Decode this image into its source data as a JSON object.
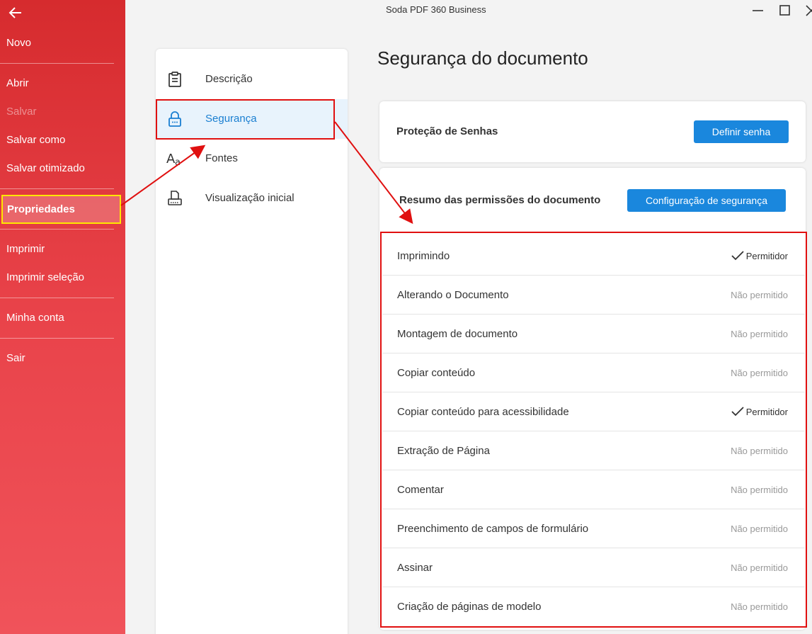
{
  "window": {
    "title": "Soda PDF 360 Business"
  },
  "sidebar": {
    "items": [
      {
        "label": "Novo"
      },
      {
        "label": "Abrir"
      },
      {
        "label": "Salvar"
      },
      {
        "label": "Salvar como"
      },
      {
        "label": "Salvar otimizado"
      },
      {
        "label": "Propriedades"
      },
      {
        "label": "Imprimir"
      },
      {
        "label": "Imprimir seleção"
      },
      {
        "label": "Minha conta"
      },
      {
        "label": "Sair"
      }
    ]
  },
  "nav": {
    "items": [
      {
        "label": "Descrição",
        "icon": "clipboard-icon"
      },
      {
        "label": "Segurança",
        "icon": "lock-icon"
      },
      {
        "label": "Fontes",
        "icon": "font-aa-icon"
      },
      {
        "label": "Visualização inicial",
        "icon": "printer-page-icon"
      }
    ]
  },
  "main": {
    "title": "Segurança do documento",
    "password_card": {
      "label": "Proteção de Senhas",
      "button": "Definir senha"
    },
    "permissions_card": {
      "label": "Resumo das permissões do documento",
      "button": "Configuração de segurança"
    },
    "permissions": [
      {
        "label": "Imprimindo",
        "status": "Permitidor",
        "allowed": true
      },
      {
        "label": "Alterando o Documento",
        "status": "Não permitido",
        "allowed": false
      },
      {
        "label": "Montagem de documento",
        "status": "Não permitido",
        "allowed": false
      },
      {
        "label": "Copiar conteúdo",
        "status": "Não permitido",
        "allowed": false
      },
      {
        "label": "Copiar conteúdo para acessibilidade",
        "status": "Permitidor",
        "allowed": true
      },
      {
        "label": "Extração de Página",
        "status": "Não permitido",
        "allowed": false
      },
      {
        "label": "Comentar",
        "status": "Não permitido",
        "allowed": false
      },
      {
        "label": "Preenchimento de campos de formulário",
        "status": "Não permitido",
        "allowed": false
      },
      {
        "label": "Assinar",
        "status": "Não permitido",
        "allowed": false
      },
      {
        "label": "Criação de páginas de modelo",
        "status": "Não permitido",
        "allowed": false
      }
    ]
  },
  "colors": {
    "sidebar_top": "#d62b2e",
    "sidebar_bottom": "#f0535a",
    "accent_blue": "#1a87dd",
    "highlight_yellow": "#ffe600",
    "annotation_red": "#e01010"
  }
}
